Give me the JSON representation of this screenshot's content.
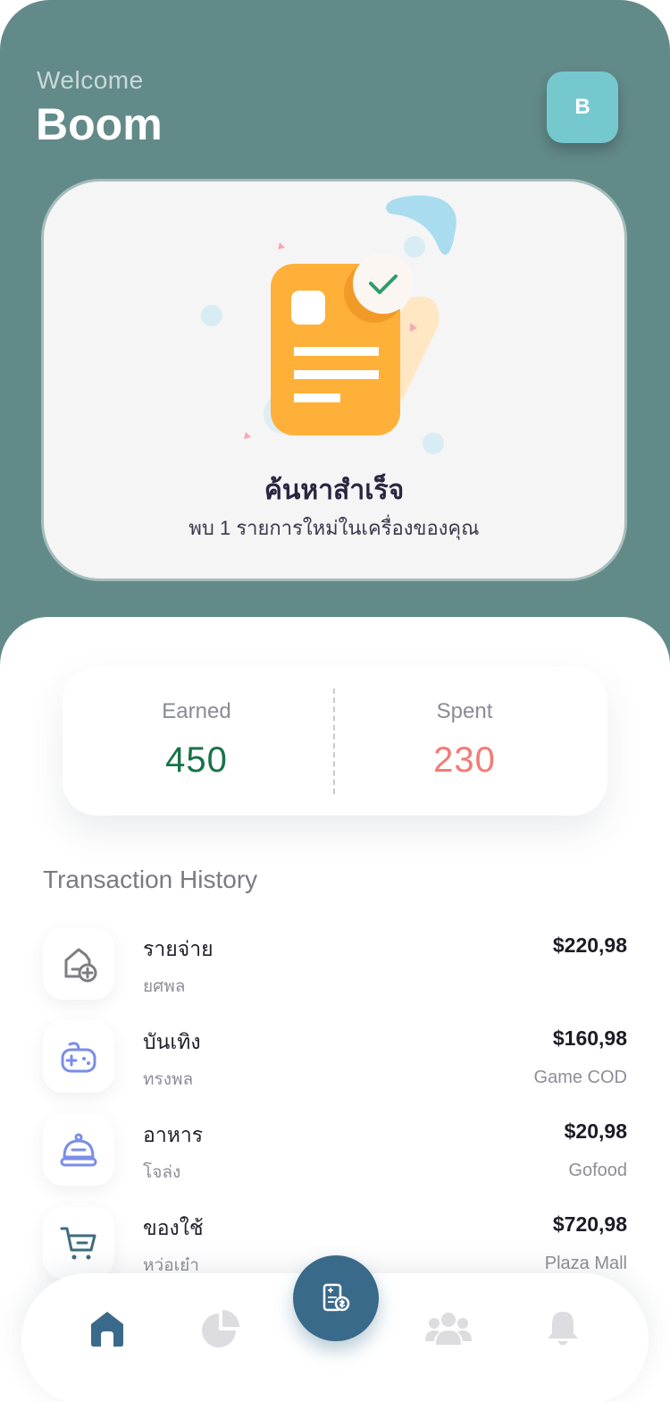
{
  "header": {
    "greeting": "Welcome",
    "username": "Boom",
    "avatar_initial": "B"
  },
  "success_card": {
    "title": "ค้นหาสำเร็จ",
    "subtitle": "พบ 1 รายการใหม่ในเครื่องของคุณ",
    "illustration": "receipt-check-icon"
  },
  "stats": {
    "earned_label": "Earned",
    "earned_value": "450",
    "spent_label": "Spent",
    "spent_value": "230"
  },
  "transactions": {
    "title": "Transaction History",
    "items": [
      {
        "icon": "wallet-add-icon",
        "title": "รายจ่าย",
        "subtitle": "ยศพล",
        "amount": "$220,98",
        "merchant": ""
      },
      {
        "icon": "gamepad-icon",
        "title": "บันเทิง",
        "subtitle": "ทรงพล",
        "amount": "$160,98",
        "merchant": "Game COD"
      },
      {
        "icon": "food-cloche-icon",
        "title": "อาหาร",
        "subtitle": "โจล่ง",
        "amount": "$20,98",
        "merchant": "Gofood"
      },
      {
        "icon": "cart-icon",
        "title": "ของใช้",
        "subtitle": "หว่อเย๋า",
        "amount": "$720,98",
        "merchant": "Plaza Mall"
      }
    ]
  },
  "nav": {
    "items": [
      "home-icon",
      "pie-chart-icon",
      "scan-receipt-icon",
      "users-icon",
      "bell-icon"
    ],
    "active": "home-icon"
  },
  "colors": {
    "header_bg": "#628a89",
    "avatar_bg": "#76c8cf",
    "earned": "#177348",
    "spent": "#f27b74",
    "accent": "#3a6a8a",
    "receipt": "#ffb038"
  }
}
